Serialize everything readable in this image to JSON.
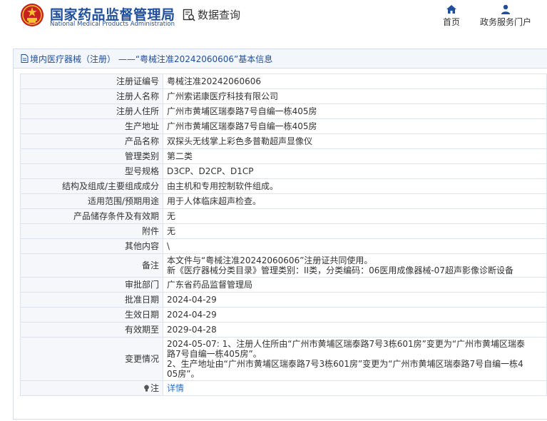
{
  "header": {
    "org_name_cn": "国家药品监督管理局",
    "org_name_en": "National Medical Products Administration",
    "data_query": "数据查询",
    "nav": {
      "home": "首页",
      "portal": "政务服务门户"
    },
    "colors": {
      "brand": "#1f4e9d",
      "emblem_red": "#c8201e",
      "emblem_gold": "#f2c230"
    }
  },
  "page": {
    "title": "境内医疗器械（注册） ——“粤械注准20242060606”基本信息",
    "title_icon": "document-icon"
  },
  "rows": [
    {
      "label": "注册证编号",
      "value": "粤械注准20242060606"
    },
    {
      "label": "注册人名称",
      "value": "广州索诺康医疗科技有限公司"
    },
    {
      "label": "注册人住所",
      "value": "广州市黄埔区瑞泰路7号自编一栋405房"
    },
    {
      "label": "生产地址",
      "value": "广州市黄埔区瑞泰路7号自编一栋405房"
    },
    {
      "label": "产品名称",
      "value": "双探头无线掌上彩色多普勒超声显像仪"
    },
    {
      "label": "管理类别",
      "value": "第二类"
    },
    {
      "label": "型号规格",
      "value": "D3CP、D2CP、D1CP"
    },
    {
      "label": "结构及组成/主要组成成分",
      "value": "由主机和专用控制软件组成。"
    },
    {
      "label": "适用范围/预期用途",
      "value": "用于人体临床超声检查。"
    },
    {
      "label": "产品储存条件及有效期",
      "value": "无"
    },
    {
      "label": "附件",
      "value": "无"
    },
    {
      "label": "其他内容",
      "value": "\\"
    }
  ],
  "remark": {
    "label": "备注",
    "lines": [
      "本文件与“粤械注准20242060606”注册证共同使用。",
      "新《医疗器械分类目录》管理类别：II类，分类编码：06医用成像器械-07超声影像诊断设备"
    ]
  },
  "rows2": [
    {
      "label": "审批部门",
      "value": "广东省药品监督管理局"
    },
    {
      "label": "批准日期",
      "value": "2024-04-29"
    },
    {
      "label": "生效日期",
      "value": "2024-04-29"
    },
    {
      "label": "有效期至",
      "value": "2029-04-28"
    }
  ],
  "changes": {
    "label": "变更情况",
    "lines": [
      "2024-05-07: 1、注册人住所由“广州市黄埔区瑞泰路7号3栋601房”变更为“广州市黄埔区瑞泰",
      "路7号自编一栋405房”。",
      "2、生产地址由“广州市黄埔区瑞泰路7号3栋601房”变更为“广州市黄埔区瑞泰路7号自编一栋4",
      "05房”。"
    ]
  },
  "note": {
    "label": "注",
    "icon": "lightbulb-icon",
    "link": "详情"
  }
}
